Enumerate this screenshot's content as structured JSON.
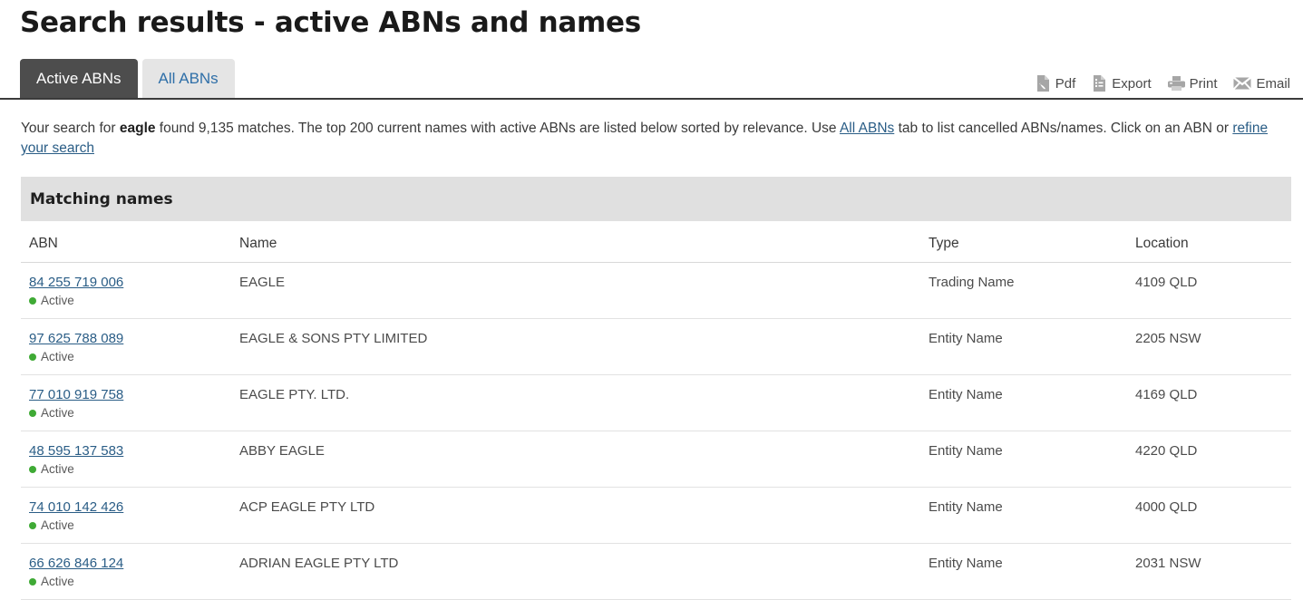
{
  "page": {
    "title": "Search results - active ABNs and names"
  },
  "tabs": [
    {
      "label": "Active ABNs",
      "state": "active"
    },
    {
      "label": "All ABNs",
      "state": "inactive"
    }
  ],
  "toolbar": [
    {
      "label": "Pdf",
      "icon": "pdf-icon"
    },
    {
      "label": "Export",
      "icon": "export-icon"
    },
    {
      "label": "Print",
      "icon": "print-icon"
    },
    {
      "label": "Email",
      "icon": "email-icon"
    }
  ],
  "intro": {
    "part1": "Your search for ",
    "term": "eagle",
    "part2": " found 9,135 matches. The top 200 current names with active ABNs are listed below sorted by relevance. Use ",
    "link_all_abns": "All ABNs",
    "part3": " tab to list cancelled ABNs/names. Click on an ABN or ",
    "link_refine": "refine your search",
    "matches": "9,135",
    "top_count": "200"
  },
  "panel": {
    "heading": "Matching names",
    "columns": {
      "abn": "ABN",
      "name": "Name",
      "type": "Type",
      "location": "Location"
    },
    "rows": [
      {
        "abn": "84 255 719 006",
        "status": "Active",
        "name": "EAGLE",
        "type": "Trading Name",
        "location": "4109 QLD"
      },
      {
        "abn": "97 625 788 089",
        "status": "Active",
        "name": "EAGLE & SONS PTY LIMITED",
        "type": "Entity Name",
        "location": "2205 NSW"
      },
      {
        "abn": "77 010 919 758",
        "status": "Active",
        "name": "EAGLE PTY. LTD.",
        "type": "Entity Name",
        "location": "4169 QLD"
      },
      {
        "abn": "48 595 137 583",
        "status": "Active",
        "name": "ABBY EAGLE",
        "type": "Entity Name",
        "location": "4220 QLD"
      },
      {
        "abn": "74 010 142 426",
        "status": "Active",
        "name": "ACP EAGLE PTY LTD",
        "type": "Entity Name",
        "location": "4000 QLD"
      },
      {
        "abn": "66 626 846 124",
        "status": "Active",
        "name": "ADRIAN EAGLE PTY LTD",
        "type": "Entity Name",
        "location": "2031 NSW"
      }
    ]
  },
  "colors": {
    "active_tab_bg": "#4d4d4d",
    "inactive_tab_bg": "#e5e5e5",
    "link": "#2a5d86",
    "panel_head_bg": "#e0e0e0",
    "status_dot": "#3faa35",
    "rule": "#3b3b3b"
  }
}
